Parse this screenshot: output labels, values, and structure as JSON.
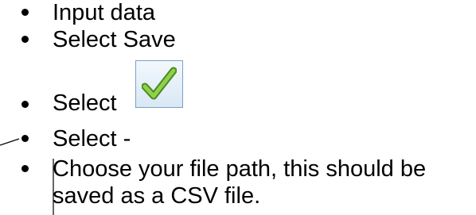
{
  "instructions": {
    "items": [
      {
        "text": "Input data"
      },
      {
        "text": "Select Save"
      },
      {
        "text": "Select"
      },
      {
        "text": "Select -"
      },
      {
        "text": "Choose your file path, this should be"
      },
      {
        "text": "saved as a CSV file."
      }
    ]
  },
  "icons": {
    "confirm": "green-checkmark-icon"
  }
}
